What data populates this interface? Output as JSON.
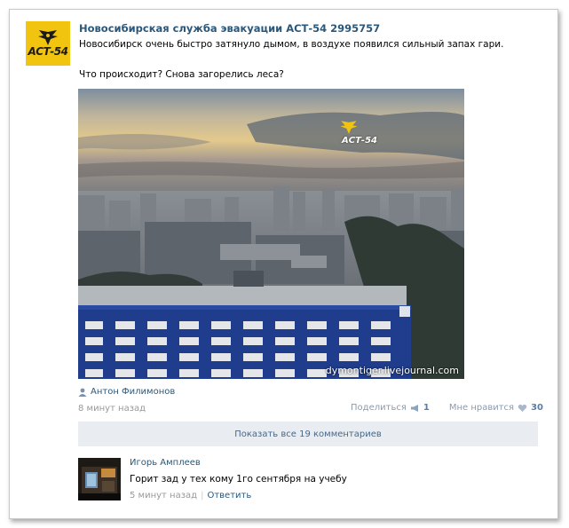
{
  "post": {
    "author": "Новосибирская служба эвакуации АСТ-54 2995757",
    "logo_text": "АСТ-54",
    "text_line1": "Новосибирск очень быстро затянуло дымом, в воздухе появился сильный запах гари.",
    "text_line2": "Что происходит? Снова загорелись леса?",
    "photo": {
      "watermark": "dymontiger.livejournal.com",
      "logo_text": "АСТ-54"
    },
    "repost_author": "Антон Филимонов",
    "time": "8 минут назад",
    "share_label": "Поделиться",
    "share_count": "1",
    "like_label": "Мне нравится",
    "like_count": "30",
    "show_comments": "Показать все 19 комментариев"
  },
  "comment": {
    "author": "Игорь Амплеев",
    "text": "Горит зад у тех кому 1го сентября на учебу",
    "time": "5 минут назад",
    "reply_label": "Ответить"
  },
  "colors": {
    "link": "#2b587a",
    "muted": "#999999",
    "bar_bg": "#e9edf1",
    "logo_bg": "#f1c40f"
  }
}
